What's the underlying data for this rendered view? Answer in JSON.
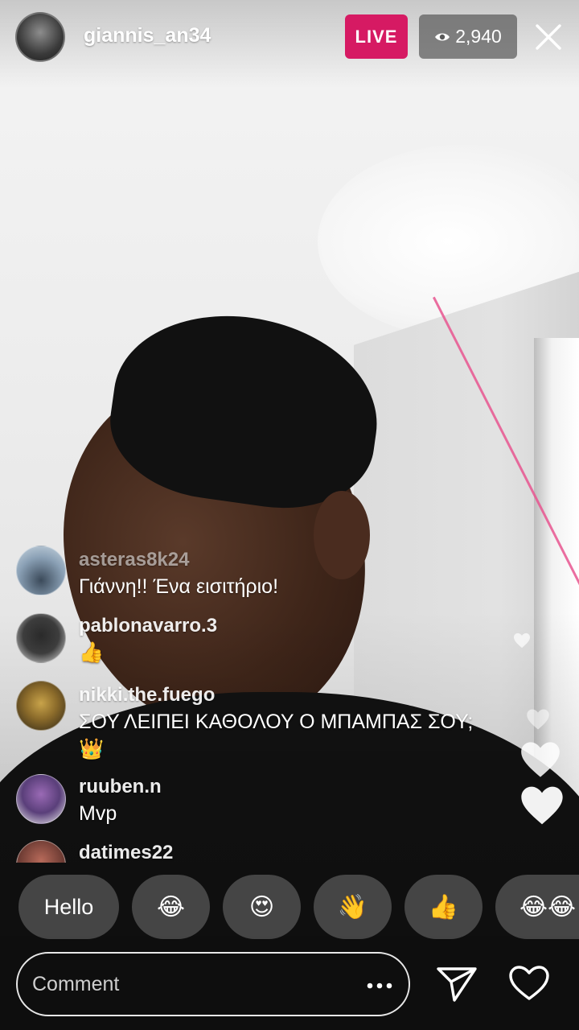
{
  "header": {
    "host_username": "giannis_an34",
    "live_label": "LIVE",
    "viewer_count": "2,940",
    "live_color": "#d61a63"
  },
  "comments": [
    {
      "username": "asteras8k24",
      "text": "Γιάννη!! Ένα εισιτήριο!"
    },
    {
      "username": "pablonavarro.3",
      "text": "👍"
    },
    {
      "username": "nikki.the.fuego",
      "text": "ΣΟΥ ΛΕΙΠΕΙ ΚΑΘΟΛΟΥ Ο ΜΠΑΜΠΑΣ ΣΟΥ;👑"
    },
    {
      "username": "ruuben.n",
      "text": "Mvp"
    },
    {
      "username": "datimes22",
      "text": ""
    }
  ],
  "quick_reactions": [
    "Hello",
    "😂",
    "😍",
    "👋",
    "👍",
    "😂😂"
  ],
  "footer": {
    "comment_placeholder": "Comment",
    "icons": [
      "more-icon",
      "send-icon",
      "heart-icon"
    ]
  }
}
